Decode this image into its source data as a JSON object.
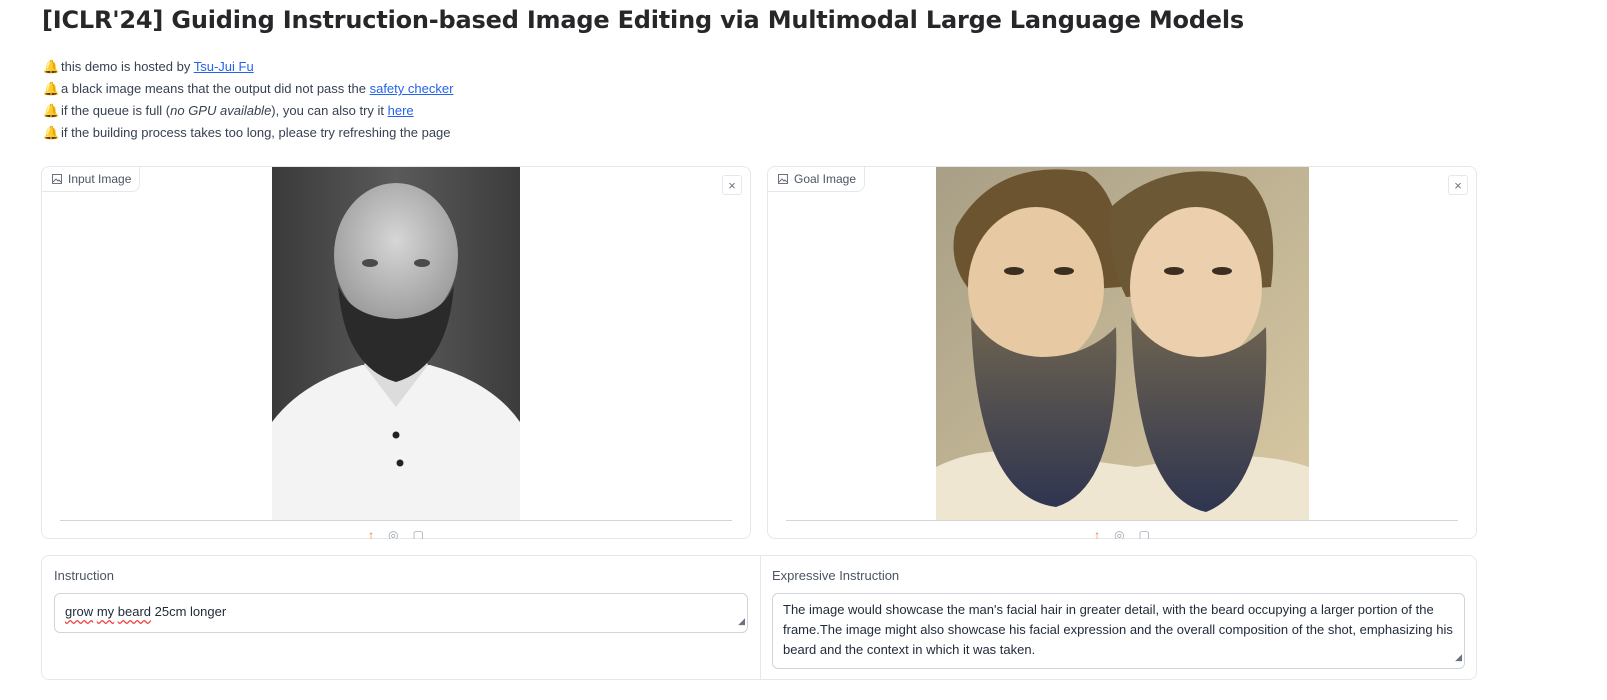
{
  "page": {
    "title": "[ICLR'24] Guiding Instruction-based Image Editing via Multimodal Large Language Models"
  },
  "notes": [
    {
      "text": "this demo is hosted by ",
      "link": "Tsu-Jui Fu",
      "after": ""
    },
    {
      "text": "a black image means that the output did not pass the ",
      "link": "safety checker",
      "after": ""
    },
    {
      "text": "if the queue is full (",
      "emphasis": "no GPU available",
      "text2": "), you can also try it ",
      "link": "here",
      "after": ""
    },
    {
      "text": "if the building process takes too long, please try refreshing the page"
    }
  ],
  "input_image": {
    "label": "Input Image",
    "icon": "image-icon"
  },
  "goal_image": {
    "label": "Goal Image",
    "icon": "image-icon"
  },
  "close_glyph": "×",
  "instruction": {
    "label": "Instruction",
    "value_word1": "grow",
    "value_word2": "my",
    "value_word3": "beard",
    "value_rest": " 25cm longer"
  },
  "expressive_instruction": {
    "label": "Expressive Instruction",
    "value": "The image would showcase the man's facial hair in greater detail, with the beard occupying a larger portion of the frame.The image might also showcase his facial expression and the overall composition of the shot, emphasizing his beard and the context in which it was taken."
  },
  "colors": {
    "accent": "#f97316",
    "link": "#2563eb",
    "bell": "#f5b300"
  }
}
